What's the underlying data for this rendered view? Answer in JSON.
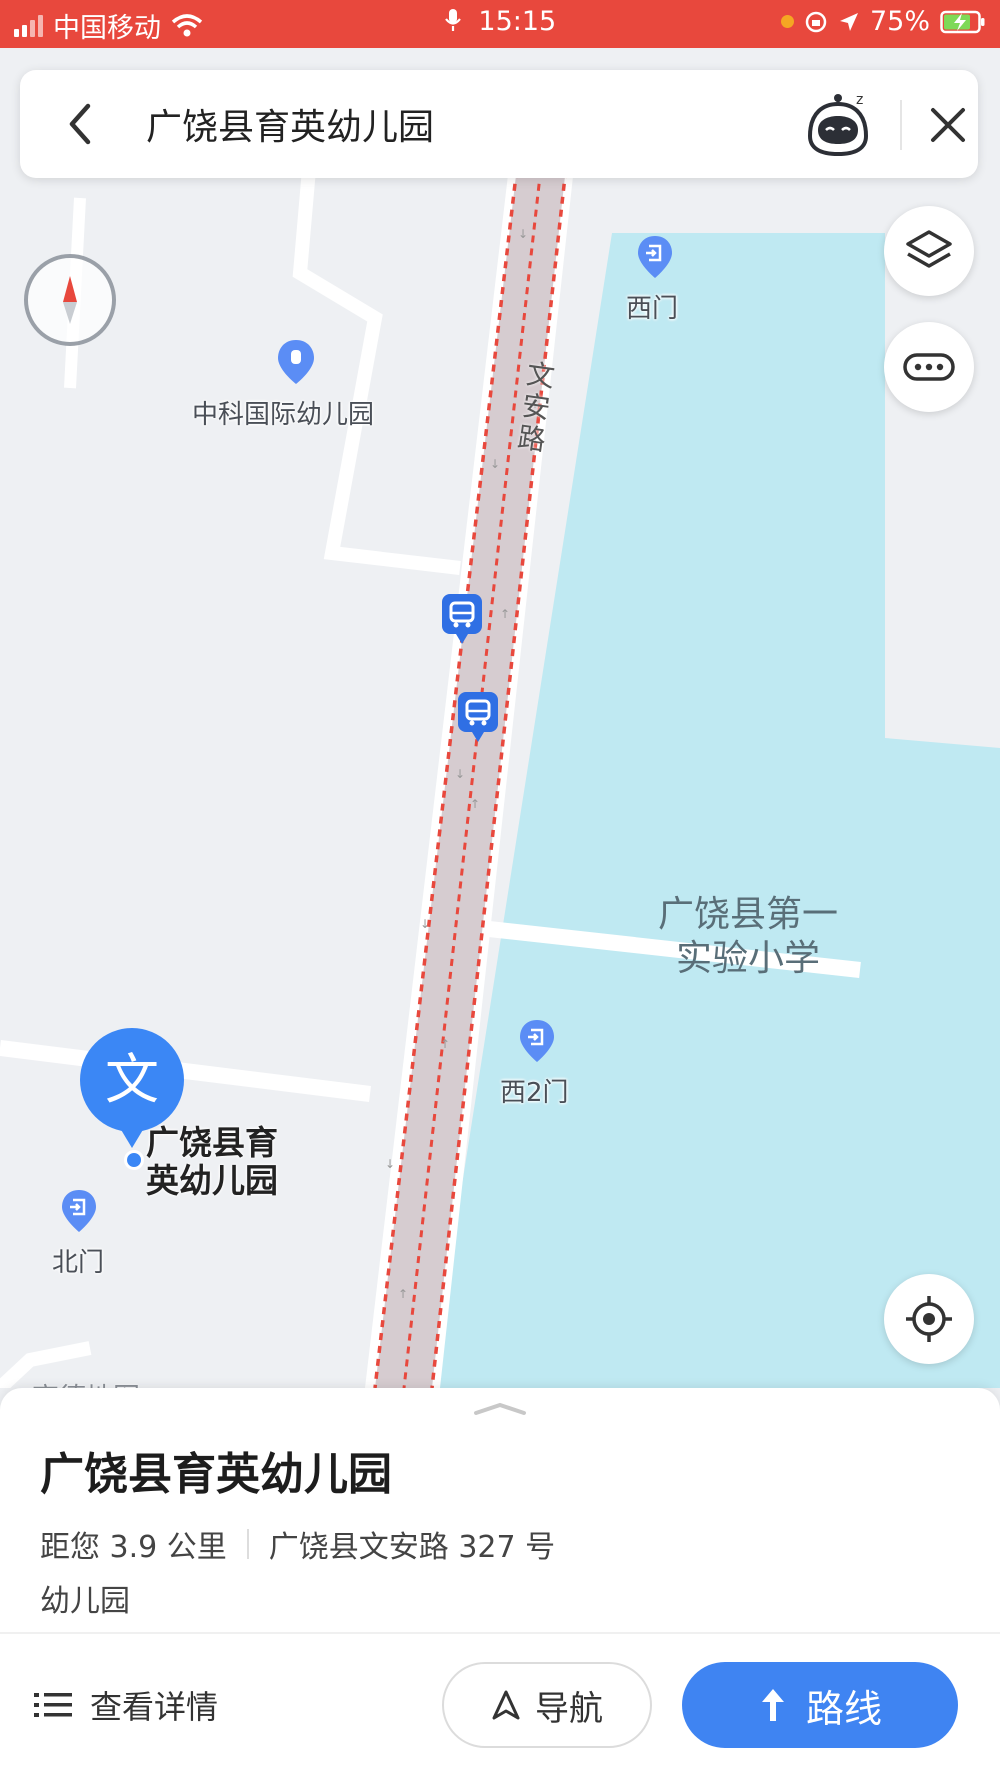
{
  "status_bar": {
    "carrier": "中国移动",
    "time": "15:15",
    "battery": "75%"
  },
  "search": {
    "query": "广饶县育英幼儿园"
  },
  "map": {
    "labels": {
      "kindergarten_poi": "中科国际幼儿园",
      "west_gate": "西门",
      "road": "文安路",
      "school_line1": "广饶县第一",
      "school_line2": "实验小学",
      "west_gate_2": "西2门",
      "north_gate": "北门",
      "selected_line1": "广饶县育",
      "selected_line2": "英幼儿园",
      "selected_pin_char": "文",
      "watermark": "高德地图"
    },
    "colors": {
      "school_area": "#bfe9f2",
      "road_fill": "#d6ccd0",
      "road_dash": "#e8483d",
      "accent": "#3b87f5"
    }
  },
  "place": {
    "name": "广饶县育英幼儿园",
    "distance": "距您 3.9 公里",
    "address": "广饶县文安路 327 号",
    "category": "幼儿园"
  },
  "actions": {
    "details": "查看详情",
    "navigate": "导航",
    "route": "路线"
  }
}
